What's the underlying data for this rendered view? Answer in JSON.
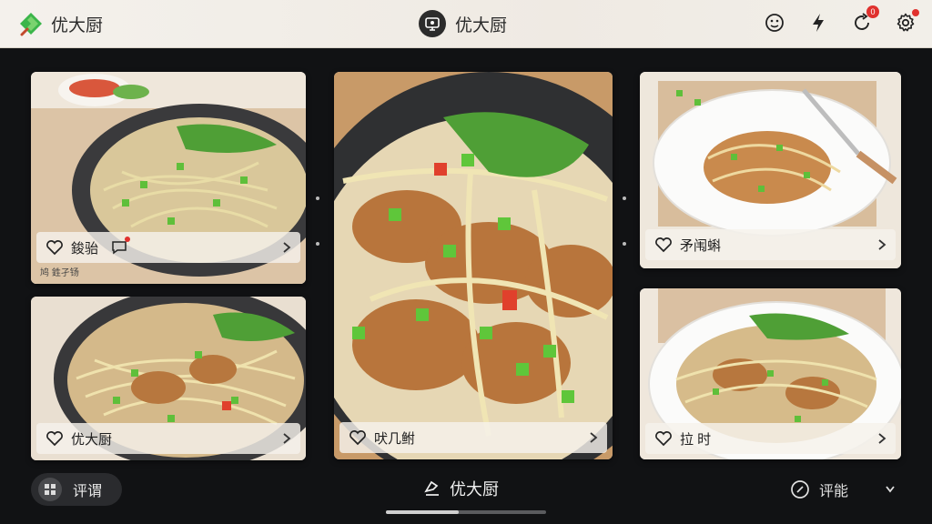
{
  "header": {
    "app_title": "优大厨",
    "center_title": "优大厨",
    "notification_count": "0"
  },
  "cards": [
    {
      "caption": "鋑骀",
      "sub": "鸠 鉎孑钖"
    },
    {
      "caption": "优大厨"
    },
    {
      "caption": "吠几鲋"
    },
    {
      "caption": "矛闱蝌"
    },
    {
      "caption": "拉 时"
    }
  ],
  "bottom": {
    "left_label": "评谓",
    "center_label": "优大厨",
    "right_label": "评能"
  },
  "colors": {
    "accent_green": "#3bb54a",
    "badge_red": "#e0312e",
    "background": "#111214"
  },
  "icons": {
    "logo": "app-logo-icon",
    "brand": "screen-chef-icon",
    "face": "smiley-icon",
    "flash": "lightning-icon",
    "refresh": "refresh-icon",
    "settings": "gear-icon"
  }
}
